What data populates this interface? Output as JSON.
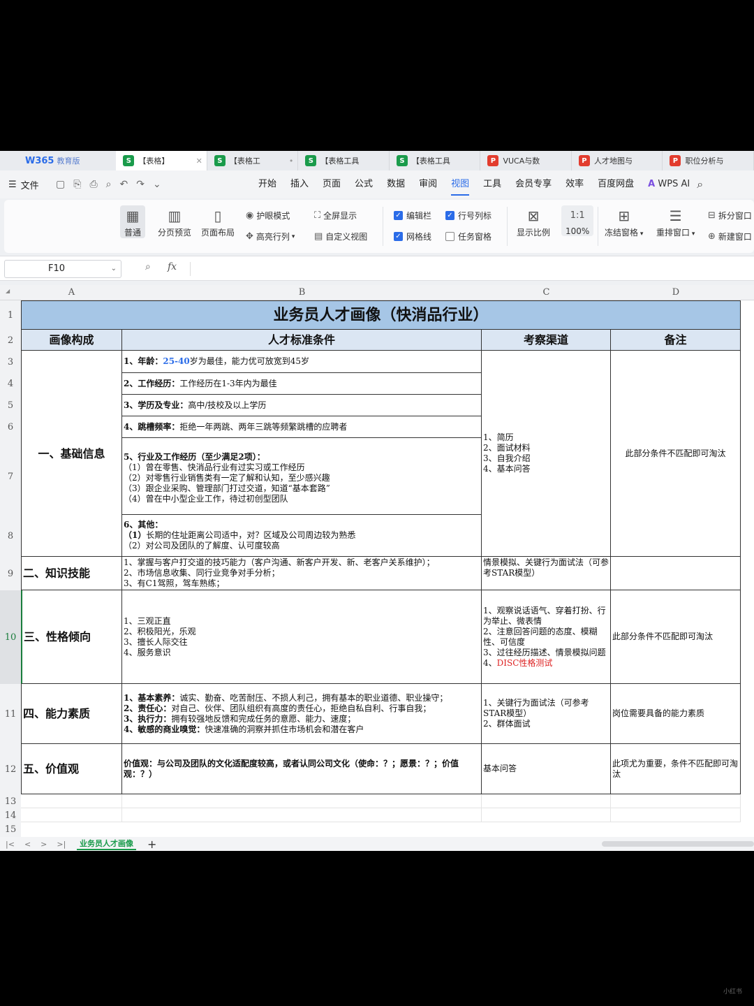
{
  "app": {
    "logo": "W365",
    "edition": "教育版"
  },
  "tabs": [
    {
      "icon": "S",
      "type": "s",
      "label": "【表格】",
      "active": true
    },
    {
      "icon": "S",
      "type": "s",
      "label": "【表格工"
    },
    {
      "icon": "S",
      "type": "s",
      "label": "【表格工具"
    },
    {
      "icon": "S",
      "type": "s",
      "label": "【表格工具"
    },
    {
      "icon": "P",
      "type": "p",
      "label": "VUCA与数"
    },
    {
      "icon": "P",
      "type": "p",
      "label": "人才地图与"
    },
    {
      "icon": "P",
      "type": "p",
      "label": "职位分析与"
    }
  ],
  "menu": {
    "file": "文件",
    "items": [
      "开始",
      "插入",
      "页面",
      "公式",
      "数据",
      "审阅",
      "视图",
      "工具",
      "会员专享",
      "效率",
      "百度网盘"
    ],
    "active": "视图",
    "ai": "WPS AI"
  },
  "ribbon": {
    "normal": "普通",
    "page_break": "分页预览",
    "page_layout": "页面布局",
    "eye_mode": "护眼模式",
    "highlight": "高亮行列",
    "fullscreen": "全屏显示",
    "custom_view": "自定义视图",
    "edit_bar": "编辑栏",
    "gridlines": "网格线",
    "headings": "行号列标",
    "task_pane": "任务窗格",
    "zoom_ratio": "显示比例",
    "zoom_100": "100%",
    "freeze": "冻结窗格",
    "rearrange": "重排窗口",
    "split": "拆分窗口",
    "new_window": "新建窗口",
    "one_one": "1:1"
  },
  "formula_bar": {
    "cell_ref": "F10",
    "fx": "fx",
    "content": ""
  },
  "columns": [
    "A",
    "B",
    "C",
    "D"
  ],
  "rows": [
    "1",
    "2",
    "3",
    "4",
    "5",
    "6",
    "7",
    "8",
    "9",
    "10",
    "11",
    "12",
    "13",
    "14",
    "15"
  ],
  "sheet": {
    "title": "业务员人才画像（快消品行业）",
    "headers": [
      "画像构成",
      "人才标准条件",
      "考察渠道",
      "备注"
    ],
    "sections": {
      "s1": "一、基础信息",
      "s2": "二、知识技能",
      "s3": "三、性格倾向",
      "s4": "四、能力素质",
      "s5": "五、价值观"
    },
    "basic": {
      "r3_label": "1、年龄：",
      "r3_age": "25-40",
      "r3_rest": "岁为最佳，能力优可放宽到45岁",
      "r4_label": "2、工作经历：",
      "r4_rest": "工作经历在1-3年内为最佳",
      "r5_label": "3、学历及专业：",
      "r5_rest": "高中/技校及以上学历",
      "r6_label": "4、跳槽频率：",
      "r6_rest": "拒绝一年两跳、两年三跳等频繁跳槽的应聘者",
      "r7_title": "5、行业及工作经历（至少满足2项）：",
      "r7_1": "（1）曾在零售、快消品行业有过实习或工作经历",
      "r7_2": "（2）对零售行业销售类有一定了解和认知，至少感兴趣",
      "r7_3": "（3）跟企业采购、管理部门打过交道，知道“基本套路”",
      "r7_4": "（4）曾在中小型企业工作，待过初创型团队",
      "r8_title": "6、其他：",
      "r8_1a": "（1）",
      "r8_1b": "长期的住址距离公司适中，对？区域及公司周边较为熟悉",
      "r8_2": "（2）对公司及团队的了解度、认可度较高",
      "channel_1": "1、简历",
      "channel_2": "2、面试材料",
      "channel_3": "3、自我介绍",
      "channel_4": "4、基本问答",
      "note": "此部分条件不匹配即可淘汰"
    },
    "knowledge": {
      "l1": "1、掌握与客户打交道的技巧能力（客户沟通、新客户开发、新、老客户关系维护）；",
      "l2": "2、市场信息收集、同行业竞争对手分析；",
      "l3": "3、有C1驾照，驾车熟练；",
      "channel": "情景模拟、关键行为面试法（可参考STAR模型）"
    },
    "personality": {
      "l1": "1、三观正直",
      "l2": "2、积极阳光，乐观",
      "l3": "3、擅长人际交往",
      "l4": "4、服务意识",
      "c1": "1、观察说话语气、穿着打扮、行为举止、微表情",
      "c2": "2、注意回答问题的态度、模糊性、可信度",
      "c3": "3、过往经历描述、情景模拟问题",
      "c4a": "4、",
      "c4b": "DISC性格测试",
      "note": "此部分条件不匹配即可淘汰"
    },
    "ability": {
      "l1a": "1、基本素养：",
      "l1b": "诚实、勤奋、吃苦耐压、不损人利己，拥有基本的职业道德、职业操守；",
      "l2a": "2、责任心：",
      "l2b": "对自己、伙伴、团队组织有高度的责任心，拒绝自私自利、行事自我；",
      "l3a": "3、执行力：",
      "l3b": "拥有较强地反馈和完成任务的意愿、能力、速度；",
      "l4a": "4、敏感的商业嗅觉：",
      "l4b": "快速准确的洞察并抓住市场机会和潜在客户",
      "c1": "1、关键行为面试法（可参考STAR模型）",
      "c2": "2、群体面试",
      "note": "岗位需要具备的能力素质"
    },
    "values": {
      "text": "价值观：与公司及团队的文化适配度较高，或者认同公司文化（使命：？；愿景：？；价值观：？）",
      "channel": "基本问答",
      "note": "此项尤为重要，条件不匹配即可淘汰"
    }
  },
  "sheet_tab": "业务员人才画像",
  "watermark": "小红书"
}
